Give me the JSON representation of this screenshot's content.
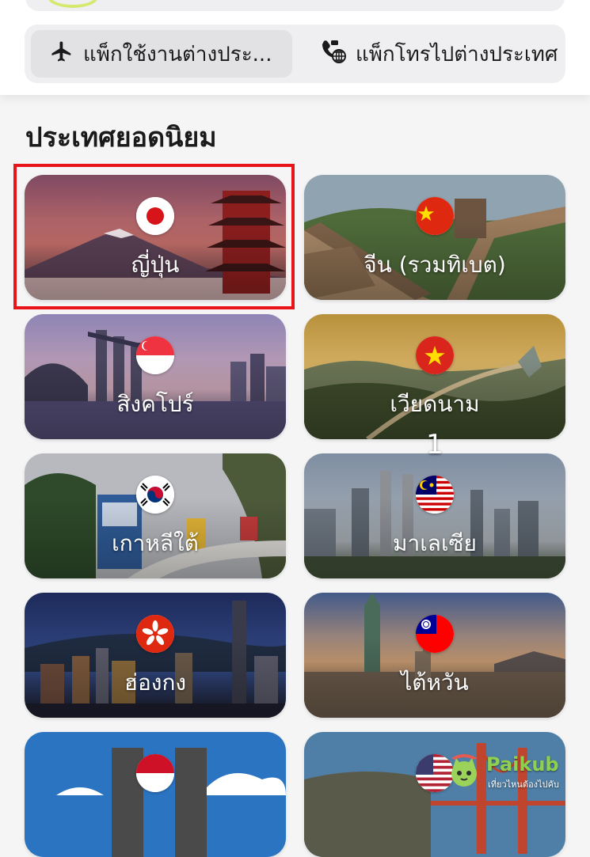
{
  "tabs": {
    "travel_label": "แพ็กใช้งานต่างประ...",
    "call_label": "แพ็กโทรไปต่างประเทศ",
    "active": "travel"
  },
  "section": {
    "title": "ประเทศยอดนิยม"
  },
  "countries": [
    {
      "name": "ญี่ปุ่น",
      "flag": "jp-flag-icon"
    },
    {
      "name": "จีน (รวมทิเบต)",
      "flag": "cn-flag-icon"
    },
    {
      "name": "สิงคโปร์",
      "flag": "sg-flag-icon"
    },
    {
      "name": "เวียดนาม",
      "flag": "vn-flag-icon"
    },
    {
      "name": "เกาหลีใต้",
      "flag": "kr-flag-icon"
    },
    {
      "name": "มาเลเซีย",
      "flag": "my-flag-icon"
    },
    {
      "name": "ฮ่องกง",
      "flag": "hk-flag-icon"
    },
    {
      "name": "ไต้หวัน",
      "flag": "tw-flag-icon"
    }
  ],
  "overlay": {
    "marker": "1",
    "highlight_color": "#e8141a",
    "highlight_target": "ญี่ปุ่น"
  },
  "watermark": {
    "brand": "Paikub",
    "tagline": "เที่ยวไหนต้องไปคับ"
  },
  "colors": {
    "background": "#f5f5f6",
    "segment": "#efeff1",
    "segment_active": "#e2e2e5"
  }
}
